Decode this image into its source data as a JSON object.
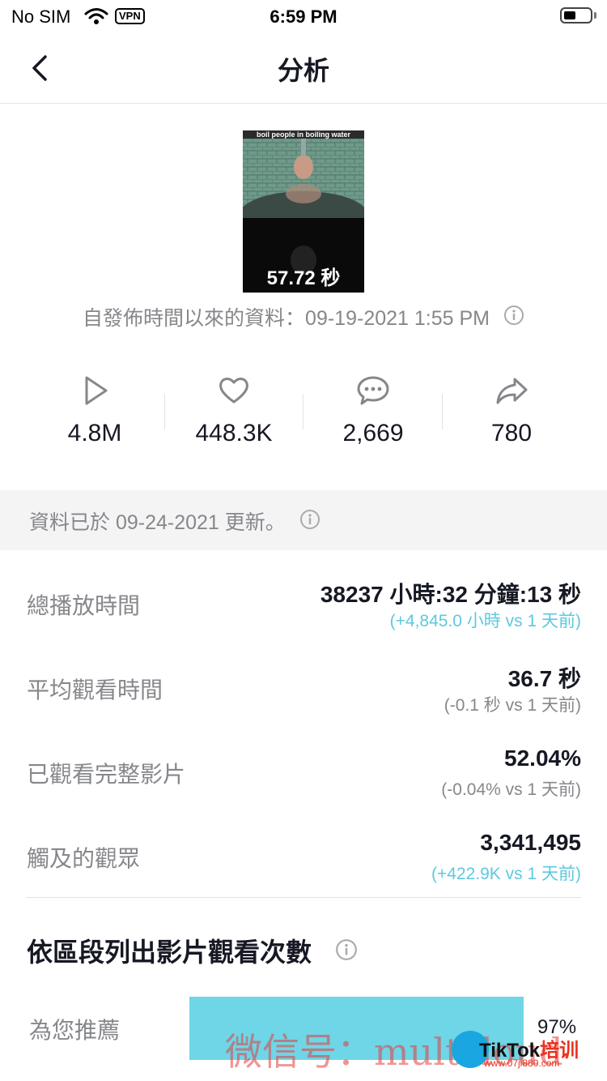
{
  "status_bar": {
    "carrier": "No SIM",
    "vpn": "VPN",
    "time": "6:59 PM"
  },
  "nav": {
    "title": "分析"
  },
  "video": {
    "caption": "boil people in boiling water",
    "duration": "57.72 秒",
    "posted_text": "自發佈時間以來的資料：09-19-2021 1:55 PM"
  },
  "stats": [
    {
      "icon": "play-icon",
      "value": "4.8M"
    },
    {
      "icon": "heart-icon",
      "value": "448.3K"
    },
    {
      "icon": "comment-icon",
      "value": "2,669"
    },
    {
      "icon": "share-icon",
      "value": "780"
    }
  ],
  "updated_text": "資料已於 09-24-2021 更新。",
  "metrics": [
    {
      "label": "總播放時間",
      "value": "38237 小時:32 分鐘:13 秒",
      "delta": "(+4,845.0 小時 vs 1 天前)",
      "delta_color": "#5dc9dd"
    },
    {
      "label": "平均觀看時間",
      "value": "36.7 秒",
      "delta": "(-0.1 秒 vs 1 天前)",
      "delta_color": "#86878b"
    },
    {
      "label": "已觀看完整影片",
      "value": "52.04%",
      "delta": "(-0.04% vs 1 天前)",
      "delta_color": "#86878b"
    },
    {
      "label": "觸及的觀眾",
      "value": "3,341,495",
      "delta": "(+422.9K vs 1 天前)",
      "delta_color": "#5dc9dd"
    }
  ],
  "section": {
    "title": "依區段列出影片觀看次數"
  },
  "traffic_sources": [
    {
      "label": "為您推薦",
      "percent": "97%",
      "fraction": 0.97
    }
  ],
  "watermark": {
    "text": "微信号：multcloud",
    "brand": "TikTok",
    "brand_cn": "培训",
    "url": "www.07ji880.com"
  },
  "colors": {
    "accent": "#5dc9dd",
    "bar": "#6ed6e6",
    "muted": "#86878b",
    "text": "#161823",
    "banner_bg": "#f4f4f5"
  }
}
